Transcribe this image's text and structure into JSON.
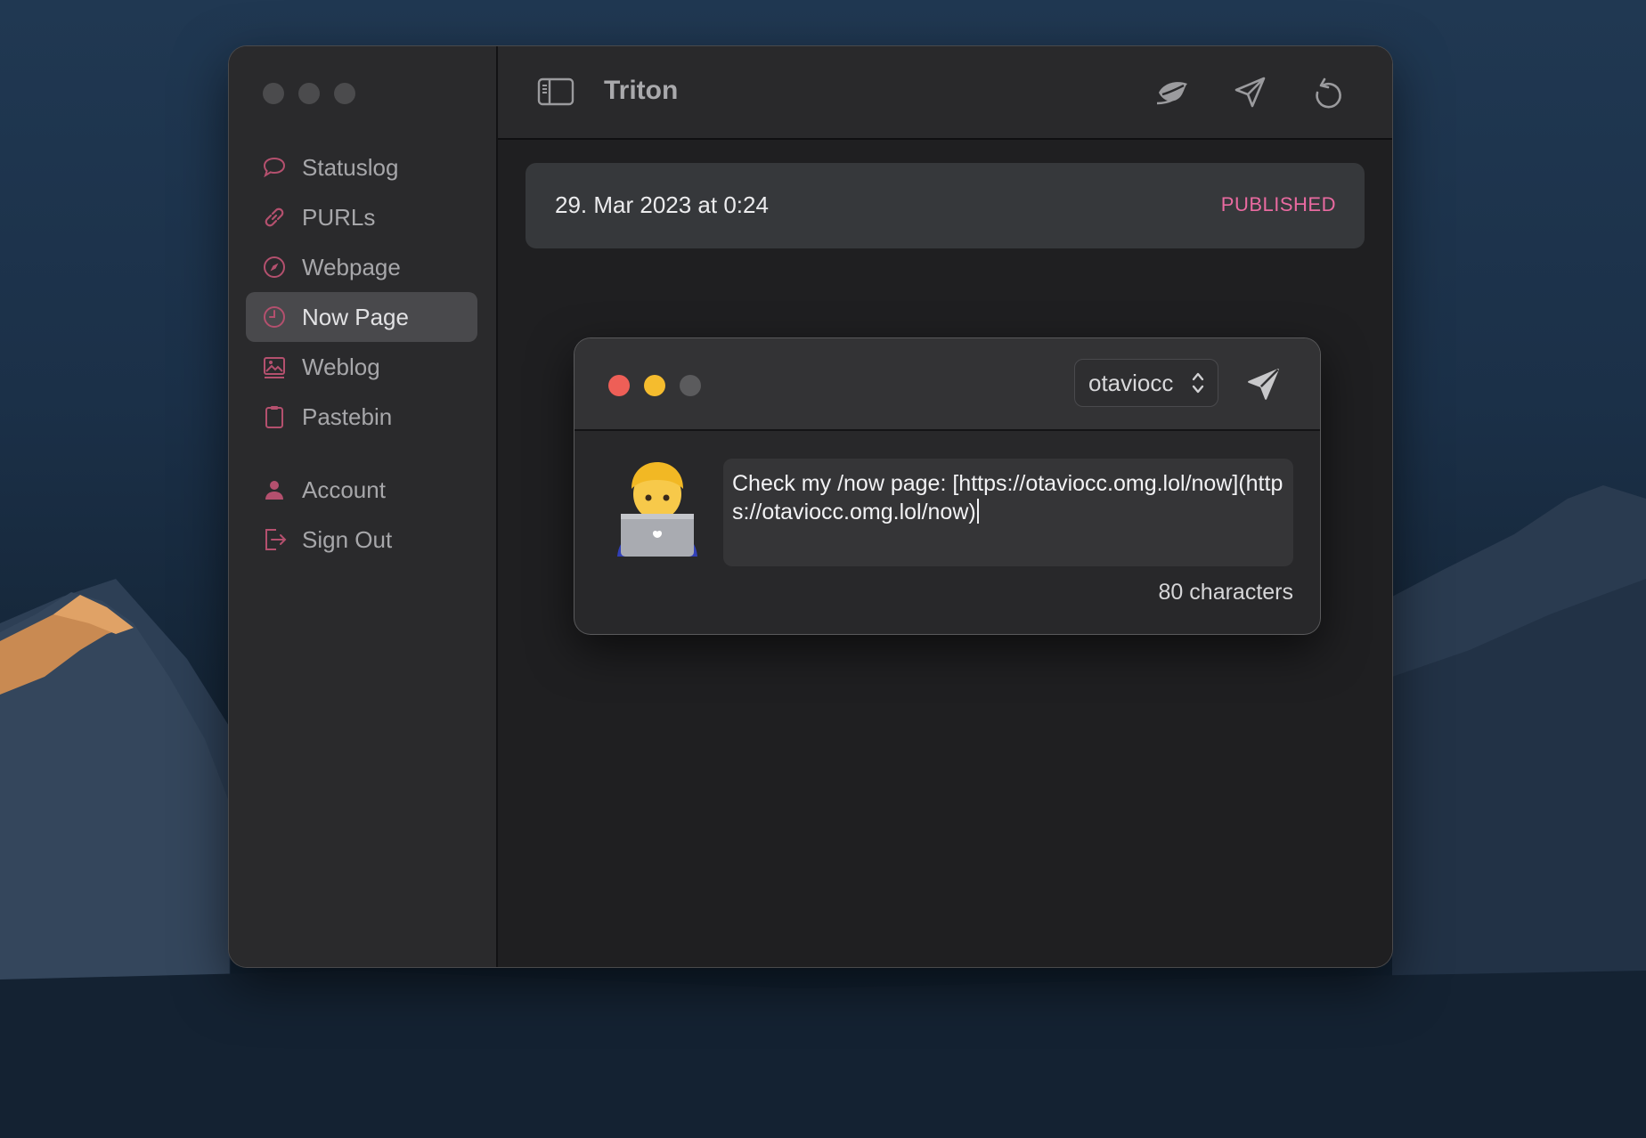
{
  "app": {
    "title": "Triton"
  },
  "sidebar": {
    "items": [
      {
        "label": "Statuslog",
        "icon": "speech-bubble-icon",
        "active": false
      },
      {
        "label": "PURLs",
        "icon": "link-icon",
        "active": false
      },
      {
        "label": "Webpage",
        "icon": "compass-icon",
        "active": false
      },
      {
        "label": "Now Page",
        "icon": "clock-icon",
        "active": true
      },
      {
        "label": "Weblog",
        "icon": "image-icon",
        "active": false
      },
      {
        "label": "Pastebin",
        "icon": "clipboard-icon",
        "active": false
      }
    ],
    "account_items": [
      {
        "label": "Account",
        "icon": "person-icon"
      },
      {
        "label": "Sign Out",
        "icon": "sign-out-icon"
      }
    ]
  },
  "toolbar": {
    "buttons": [
      "leaf-icon",
      "paper-plane-icon",
      "refresh-icon"
    ]
  },
  "status_card": {
    "date": "29. Mar 2023 at 0:24",
    "badge": "PUBLISHED"
  },
  "compose": {
    "account": "otaviocc",
    "text": "Check my /now page: [https://otaviocc.omg.lol/now](https://otaviocc.omg.lol/now)",
    "char_count": "80 characters"
  },
  "colors": {
    "accent": "#e96aa0",
    "sidebar_icon": "#b4506e",
    "traffic_red": "#ee5f57",
    "traffic_yellow": "#f5bc2e"
  }
}
